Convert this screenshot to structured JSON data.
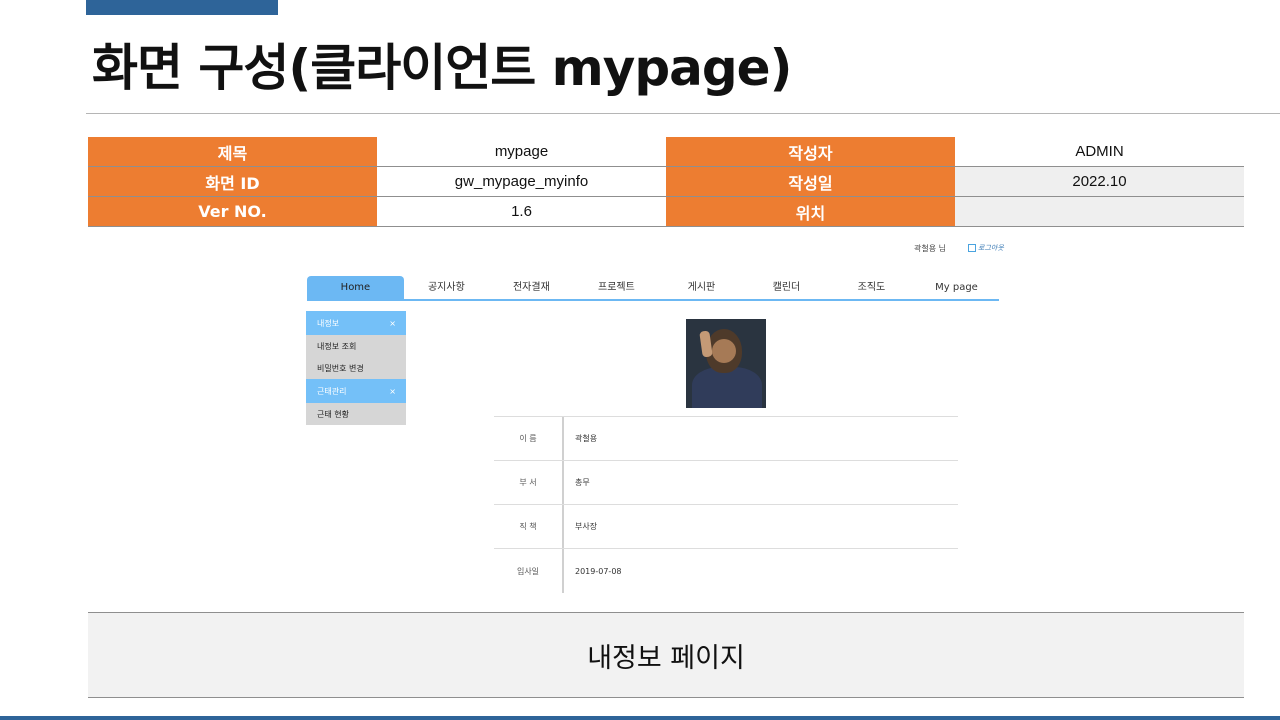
{
  "slide": {
    "title": "화면 구성(클라이언트 mypage)"
  },
  "meta": {
    "rows": [
      {
        "label1": "제목",
        "value1": "mypage",
        "label2": "작성자",
        "value2": "ADMIN"
      },
      {
        "label1": "화면 ID",
        "value1": "gw_mypage_myinfo",
        "label2": "작성일",
        "value2": "2022.10"
      },
      {
        "label1": "Ver NO.",
        "value1": "1.6",
        "label2": "위치",
        "value2": ""
      }
    ]
  },
  "app": {
    "user": "곽철용 님",
    "logout": "로그아웃",
    "nav": [
      "Home",
      "공지사항",
      "전자결재",
      "프로젝트",
      "게시판",
      "캘린더",
      "조직도",
      "My page"
    ],
    "sidebar": {
      "groups": [
        {
          "label": "내정보",
          "toggle": "×",
          "items": [
            "내정보 조회",
            "비밀번호 변경"
          ]
        },
        {
          "label": "근태관리",
          "toggle": "×",
          "items": [
            "근태 현황"
          ]
        }
      ]
    },
    "profile": {
      "rows": [
        {
          "label": "이 름",
          "value": "곽철용"
        },
        {
          "label": "부 서",
          "value": "총무"
        },
        {
          "label": "직 책",
          "value": "부사장"
        },
        {
          "label": "입사일",
          "value": "2019-07-08"
        }
      ]
    }
  },
  "caption": "내정보 페이지",
  "colors": {
    "header": "#ed7d31",
    "accent": "#2e6499",
    "nav": "#6cb8f3"
  }
}
